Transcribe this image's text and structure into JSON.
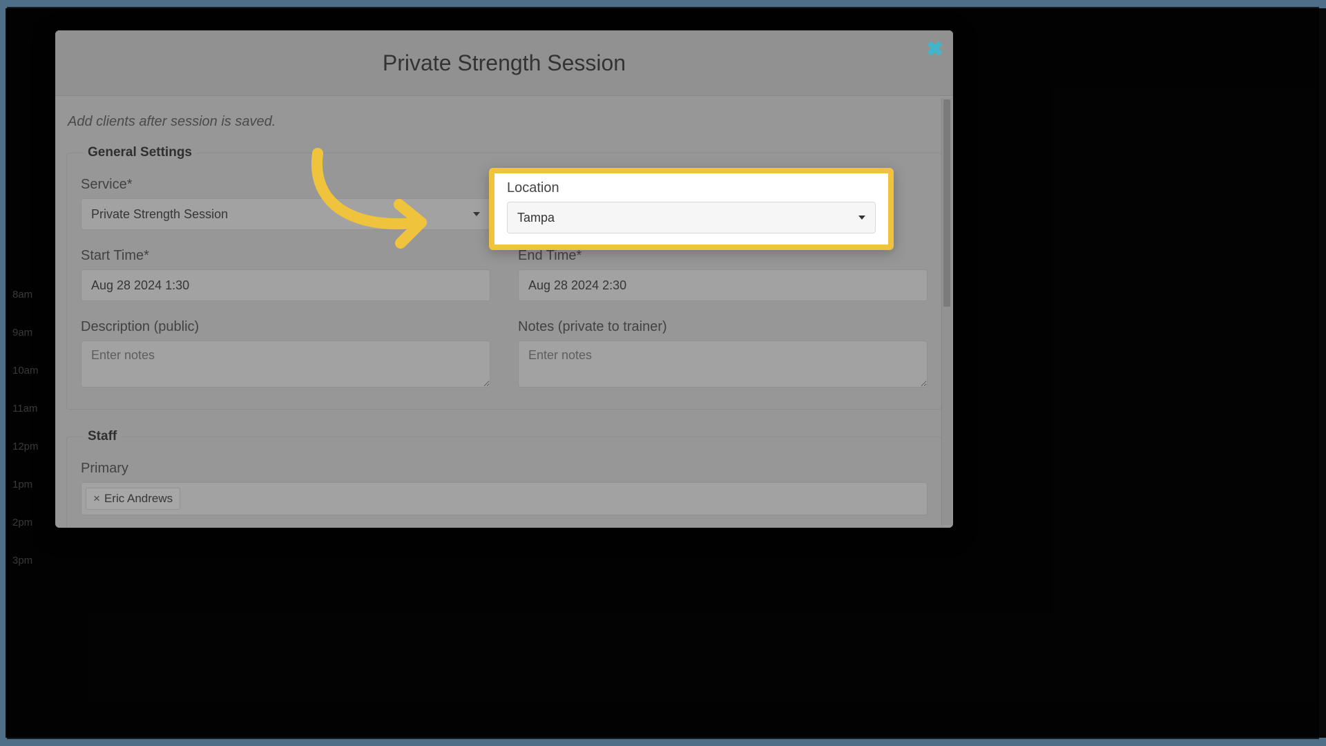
{
  "modal": {
    "title": "Private Strength Session",
    "hint": "Add clients after session is saved."
  },
  "sections": {
    "general": {
      "legend": "General Settings",
      "service_label": "Service*",
      "service_value": "Private Strength Session",
      "location_label": "Location",
      "location_value": "Tampa",
      "start_label": "Start Time*",
      "start_value": "Aug 28 2024 1:30",
      "end_label": "End Time*",
      "end_value": "Aug 28 2024 2:30",
      "desc_label": "Description (public)",
      "desc_placeholder": "Enter notes",
      "notes_label": "Notes (private to trainer)",
      "notes_placeholder": "Enter notes"
    },
    "staff": {
      "legend": "Staff",
      "primary_label": "Primary",
      "primary_tag": "Eric Andrews"
    }
  },
  "bg_times": [
    "8am",
    "9am",
    "10am",
    "11am",
    "12pm",
    "1pm",
    "2pm",
    "3pm"
  ],
  "annotation": {
    "arrow_color": "#f0c33c",
    "highlight_color": "#f0c33c"
  }
}
